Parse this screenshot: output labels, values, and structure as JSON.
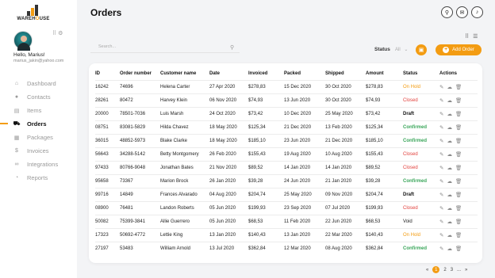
{
  "sidebar": {
    "logo_text_a": "WAREH",
    "logo_text_o": "O",
    "logo_text_b": "USE",
    "greeting": "Hello, Marius!",
    "email": "marius_jakin@yahoo.com",
    "items": [
      {
        "label": "Dashboard",
        "icon": "home-icon"
      },
      {
        "label": "Contacts",
        "icon": "user-icon"
      },
      {
        "label": "Items",
        "icon": "list-icon"
      },
      {
        "label": "Orders",
        "icon": "cart-icon",
        "active": true
      },
      {
        "label": "Packages",
        "icon": "package-icon"
      },
      {
        "label": "Invoices",
        "icon": "dollar-icon"
      },
      {
        "label": "Integrations",
        "icon": "link-icon"
      },
      {
        "label": "Reports",
        "icon": "chart-icon"
      }
    ]
  },
  "header": {
    "title": "Orders"
  },
  "toolbar": {
    "search_placeholder": "Search...",
    "status_label": "Status",
    "status_value": "All",
    "add_label": "Add Order"
  },
  "table": {
    "columns": [
      "ID",
      "Order number",
      "Customer name",
      "Date",
      "Invoiced",
      "Packed",
      "Shipped",
      "Amount",
      "Status",
      "Actions"
    ],
    "rows": [
      {
        "id": "16242",
        "order": "74696",
        "customer": "Helena Carter",
        "date": "27 Apr 2020",
        "invoiced": "$278,83",
        "packed": "15 Dec 2020",
        "shipped": "30 Oct 2020",
        "amount": "$278,83",
        "status": "On Hold"
      },
      {
        "id": "28261",
        "order": "80472",
        "customer": "Harvey Klein",
        "date": "06 Nov 2020",
        "invoiced": "$74,93",
        "packed": "13 Jun 2020",
        "shipped": "30 Oct 2020",
        "amount": "$74,93",
        "status": "Closed"
      },
      {
        "id": "20000",
        "order": "78501-7036",
        "customer": "Luis Marsh",
        "date": "24 Oct 2020",
        "invoiced": "$73,42",
        "packed": "10 Dec 2020",
        "shipped": "25 May 2020",
        "amount": "$73,42",
        "status": "Draft"
      },
      {
        "id": "08751",
        "order": "83081-5829",
        "customer": "Hilda Chavez",
        "date": "18 May 2020",
        "invoiced": "$125,34",
        "packed": "21 Dec 2020",
        "shipped": "13 Feb 2020",
        "amount": "$125,34",
        "status": "Confirmed"
      },
      {
        "id": "36015",
        "order": "48852-5973",
        "customer": "Blake Clarke",
        "date": "18 May 2020",
        "invoiced": "$185,10",
        "packed": "23 Jun 2020",
        "shipped": "21 Dec 2020",
        "amount": "$185,10",
        "status": "Confirmed"
      },
      {
        "id": "56643",
        "order": "34288-5142",
        "customer": "Betty Montgomery",
        "date": "26 Feb 2020",
        "invoiced": "$155,43",
        "packed": "19 Aug 2020",
        "shipped": "10 Aug 2020",
        "amount": "$155,43",
        "status": "Closed"
      },
      {
        "id": "97433",
        "order": "80766-9048",
        "customer": "Jonathan Bates",
        "date": "21 Nov 2020",
        "invoiced": "$89,52",
        "packed": "14 Jan 2020",
        "shipped": "14 Jan 2020",
        "amount": "$89,52",
        "status": "Closed"
      },
      {
        "id": "95658",
        "order": "73367",
        "customer": "Marion Brock",
        "date": "26 Jan 2020",
        "invoiced": "$39,28",
        "packed": "24 Jun 2020",
        "shipped": "21 Jan 2020",
        "amount": "$39,28",
        "status": "Confirmed"
      },
      {
        "id": "99716",
        "order": "14849",
        "customer": "Frances Alvarado",
        "date": "04 Aug 2020",
        "invoiced": "$204,74",
        "packed": "25 May 2020",
        "shipped": "09 Nov 2020",
        "amount": "$204,74",
        "status": "Draft"
      },
      {
        "id": "08900",
        "order": "76481",
        "customer": "Landon Roberts",
        "date": "05 Jun 2020",
        "invoiced": "$199,93",
        "packed": "23 Sep 2020",
        "shipped": "07 Jul 2020",
        "amount": "$199,93",
        "status": "Closed"
      },
      {
        "id": "50082",
        "order": "75399-3841",
        "customer": "Allie Guerrero",
        "date": "05 Jun 2020",
        "invoiced": "$68,53",
        "packed": "11 Feb 2020",
        "shipped": "22 Jun 2020",
        "amount": "$68,53",
        "status": "Void"
      },
      {
        "id": "17323",
        "order": "50692-4772",
        "customer": "Lettie King",
        "date": "13 Jan 2020",
        "invoiced": "$140,43",
        "packed": "13 Jan 2020",
        "shipped": "22 Mar 2020",
        "amount": "$140,43",
        "status": "On Hold"
      },
      {
        "id": "27197",
        "order": "53483",
        "customer": "William Arnold",
        "date": "13 Jul 2020",
        "invoiced": "$362,84",
        "packed": "12 Mar 2020",
        "shipped": "08 Aug 2020",
        "amount": "$362,84",
        "status": "Confirmed"
      }
    ]
  },
  "pagination": {
    "prev": "«",
    "pages": [
      "1",
      "2",
      "3",
      "..."
    ],
    "current": "1",
    "next": "»"
  },
  "colors": {
    "accent": "#f39c12",
    "closed": "#e2403c",
    "confirmed": "#3aa65a"
  }
}
